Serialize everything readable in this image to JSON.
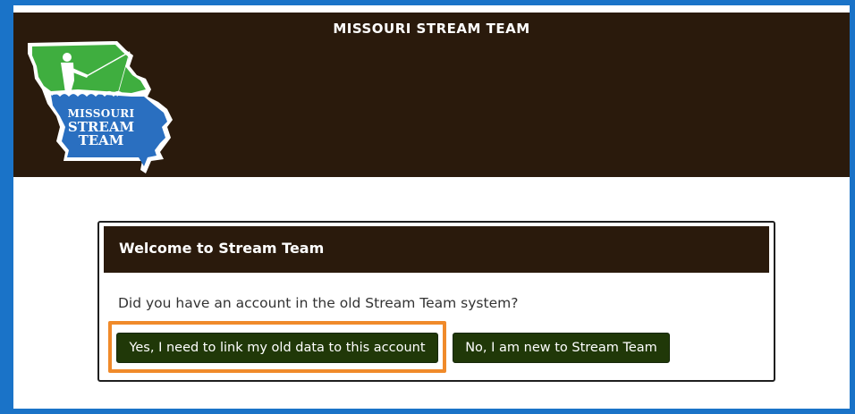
{
  "header": {
    "title": "MISSOURI STREAM TEAM",
    "logo": {
      "line1": "MISSOURI",
      "line2": "STREAM",
      "line3": "TEAM",
      "icon": "missouri-map-fisherman-logo"
    }
  },
  "welcome": {
    "title": "Welcome to Stream Team",
    "question": "Did you have an account in the old Stream Team system?",
    "yes_label": "Yes, I need to link my old data to this account",
    "no_label": "No, I am new to Stream Team"
  },
  "colors": {
    "frame": "#1a73c8",
    "header_bg": "#2a1a0c",
    "button_bg": "#203808",
    "highlight": "#f08a2a",
    "logo_green": "#3fae3f",
    "logo_blue": "#2a6fc0"
  }
}
